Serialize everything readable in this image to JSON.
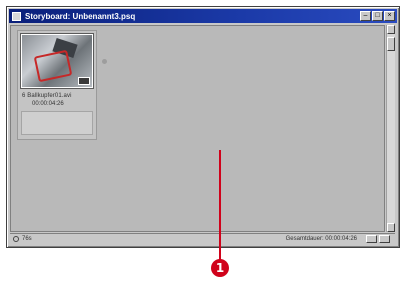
{
  "window": {
    "title": "Storyboard: Unbenannt3.psq"
  },
  "clip": {
    "name": "Ballkupfer01.avi",
    "index_label": "6",
    "duration": "00:00:04:26",
    "comment": ""
  },
  "statusbar": {
    "zoom_text": "76s",
    "total_text": "Gesamtdauer: 00:00:04:26"
  },
  "callout": {
    "number": "1"
  },
  "icons": [
    "window-app-icon",
    "minimize-icon",
    "maximize-icon",
    "close-icon",
    "film-icon",
    "zoom-icon",
    "scroll-up-icon",
    "scroll-down-icon",
    "view-mode-icon"
  ],
  "colors": {
    "title_bar": "#1b3aa8",
    "callout": "#d0021b",
    "workspace": "#b9b9b9"
  }
}
